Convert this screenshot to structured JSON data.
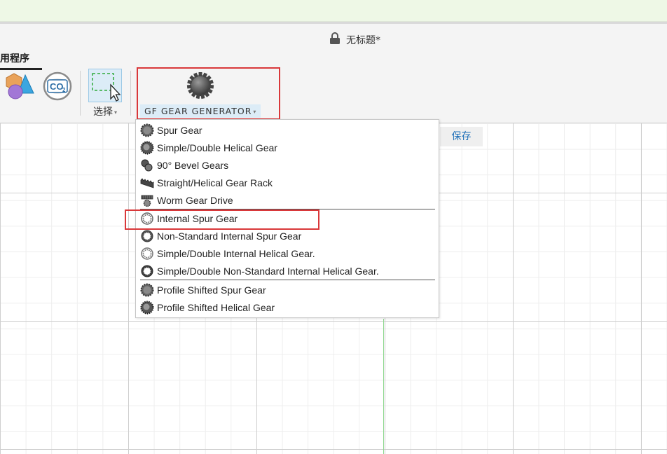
{
  "window": {
    "title": "无标题*",
    "lock_icon": "lock-icon"
  },
  "ribbon": {
    "tab_label": "用程序",
    "shapes_icon": "shapes-icon",
    "co2_icon": "co2-icon",
    "co2_text": "CO",
    "co2_sub": "2",
    "select_label": "选择",
    "select_caret": "▾",
    "gf_label": "GF GEAR GENERATOR",
    "gf_caret": "▾"
  },
  "canvas": {
    "save_label": "保存"
  },
  "menu": {
    "items": [
      {
        "label": "Spur Gear",
        "icon": "spur-gear-icon"
      },
      {
        "label": "Simple/Double Helical Gear",
        "icon": "helical-gear-icon"
      },
      {
        "label": "90° Bevel Gears",
        "icon": "bevel-gear-icon"
      },
      {
        "label": "Straight/Helical Gear Rack",
        "icon": "gear-rack-icon"
      },
      {
        "label": "Worm Gear Drive",
        "icon": "worm-gear-icon"
      },
      {
        "label": "Internal Spur Gear",
        "icon": "internal-gear-icon"
      },
      {
        "label": "Non-Standard Internal Spur Gear",
        "icon": "nonstandard-internal-gear-icon"
      },
      {
        "label": "Simple/Double Internal Helical Gear.",
        "icon": "internal-helical-gear-icon"
      },
      {
        "label": "Simple/Double Non-Standard Internal Helical Gear.",
        "icon": "nonstandard-internal-helical-gear-icon"
      },
      {
        "label": "Profile Shifted Spur Gear",
        "icon": "profile-shifted-spur-gear-icon"
      },
      {
        "label": "Profile Shifted Helical Gear",
        "icon": "profile-shifted-helical-gear-icon"
      }
    ]
  },
  "colors": {
    "highlight_red": "#d9383a",
    "accent_blue": "#1d6fb8",
    "select_bg": "#dcecf7"
  }
}
